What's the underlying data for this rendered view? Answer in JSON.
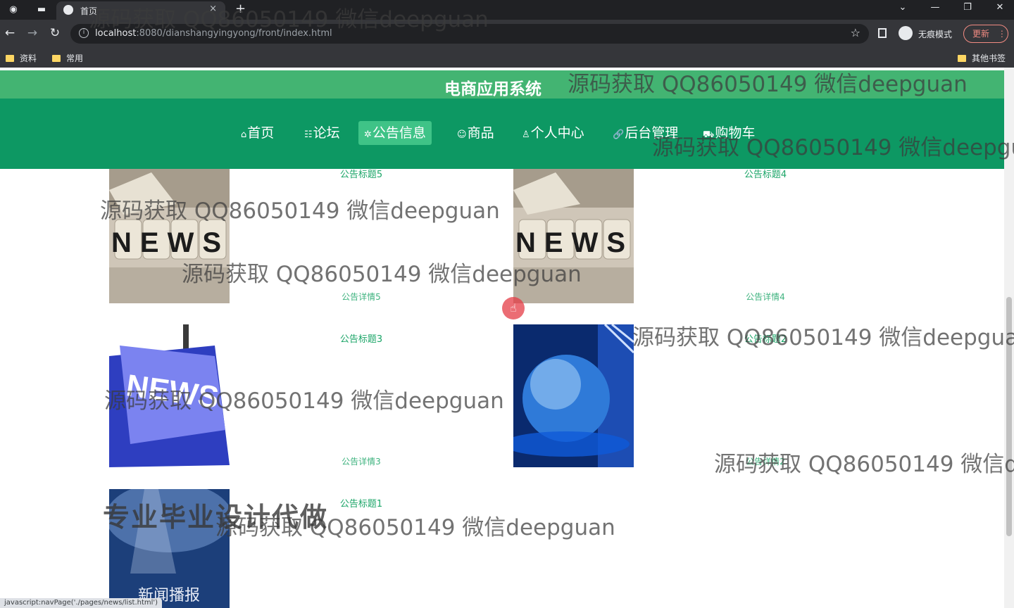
{
  "browser": {
    "tab_title": "首页",
    "tab_close": "×",
    "new_tab": "+",
    "url_host": "localhost",
    "url_path": ":8080/dianshangyingyong/front/index.html",
    "incognito_label": "无痕模式",
    "update_label": "更新",
    "bookmarks": [
      "资料",
      "常用"
    ],
    "other_bookmarks": "其他书签",
    "status_url": "javascript:navPage('./pages/news/list.html')"
  },
  "site": {
    "title": "电商应用系统",
    "nav": [
      {
        "icon": "⌂",
        "label": "首页"
      },
      {
        "icon": "☷",
        "label": "论坛"
      },
      {
        "icon": "✲",
        "label": "公告信息"
      },
      {
        "icon": "☺",
        "label": "商品"
      },
      {
        "icon": "♙",
        "label": "个人中心"
      },
      {
        "icon": "🔗",
        "label": "后台管理"
      },
      {
        "icon": "⛟",
        "label": "购物车"
      }
    ],
    "active_nav": "公告信息"
  },
  "news": [
    {
      "title": "公告标题5",
      "detail": "公告详情5",
      "image": "news-dice-image"
    },
    {
      "title": "公告标题4",
      "detail": "公告详情4",
      "image": "news-dice-image"
    },
    {
      "title": "公告标题3",
      "detail": "公告详情3",
      "image": "news-key-image"
    },
    {
      "title": "公告标题2",
      "detail": "公告详情2",
      "image": "globe-image"
    },
    {
      "title": "公告标题1",
      "detail": "",
      "image": "news-broadcast-image"
    }
  ],
  "image_text": {
    "news": "NEWS",
    "broadcast": "新闻播报"
  },
  "overlays": {
    "watermark": "源码获取 QQ86050149 微信deepguan",
    "watermark_cut1": "源码获取 QQ86050149 微信deepgua",
    "watermark_cut2": "源码获取 QQ86050149 微信de",
    "promo": "专业毕业设计代做"
  },
  "colors": {
    "header": "#43b472",
    "navbar": "#0d9863",
    "nav_active": "#3fc387",
    "link": "#1aa567"
  }
}
